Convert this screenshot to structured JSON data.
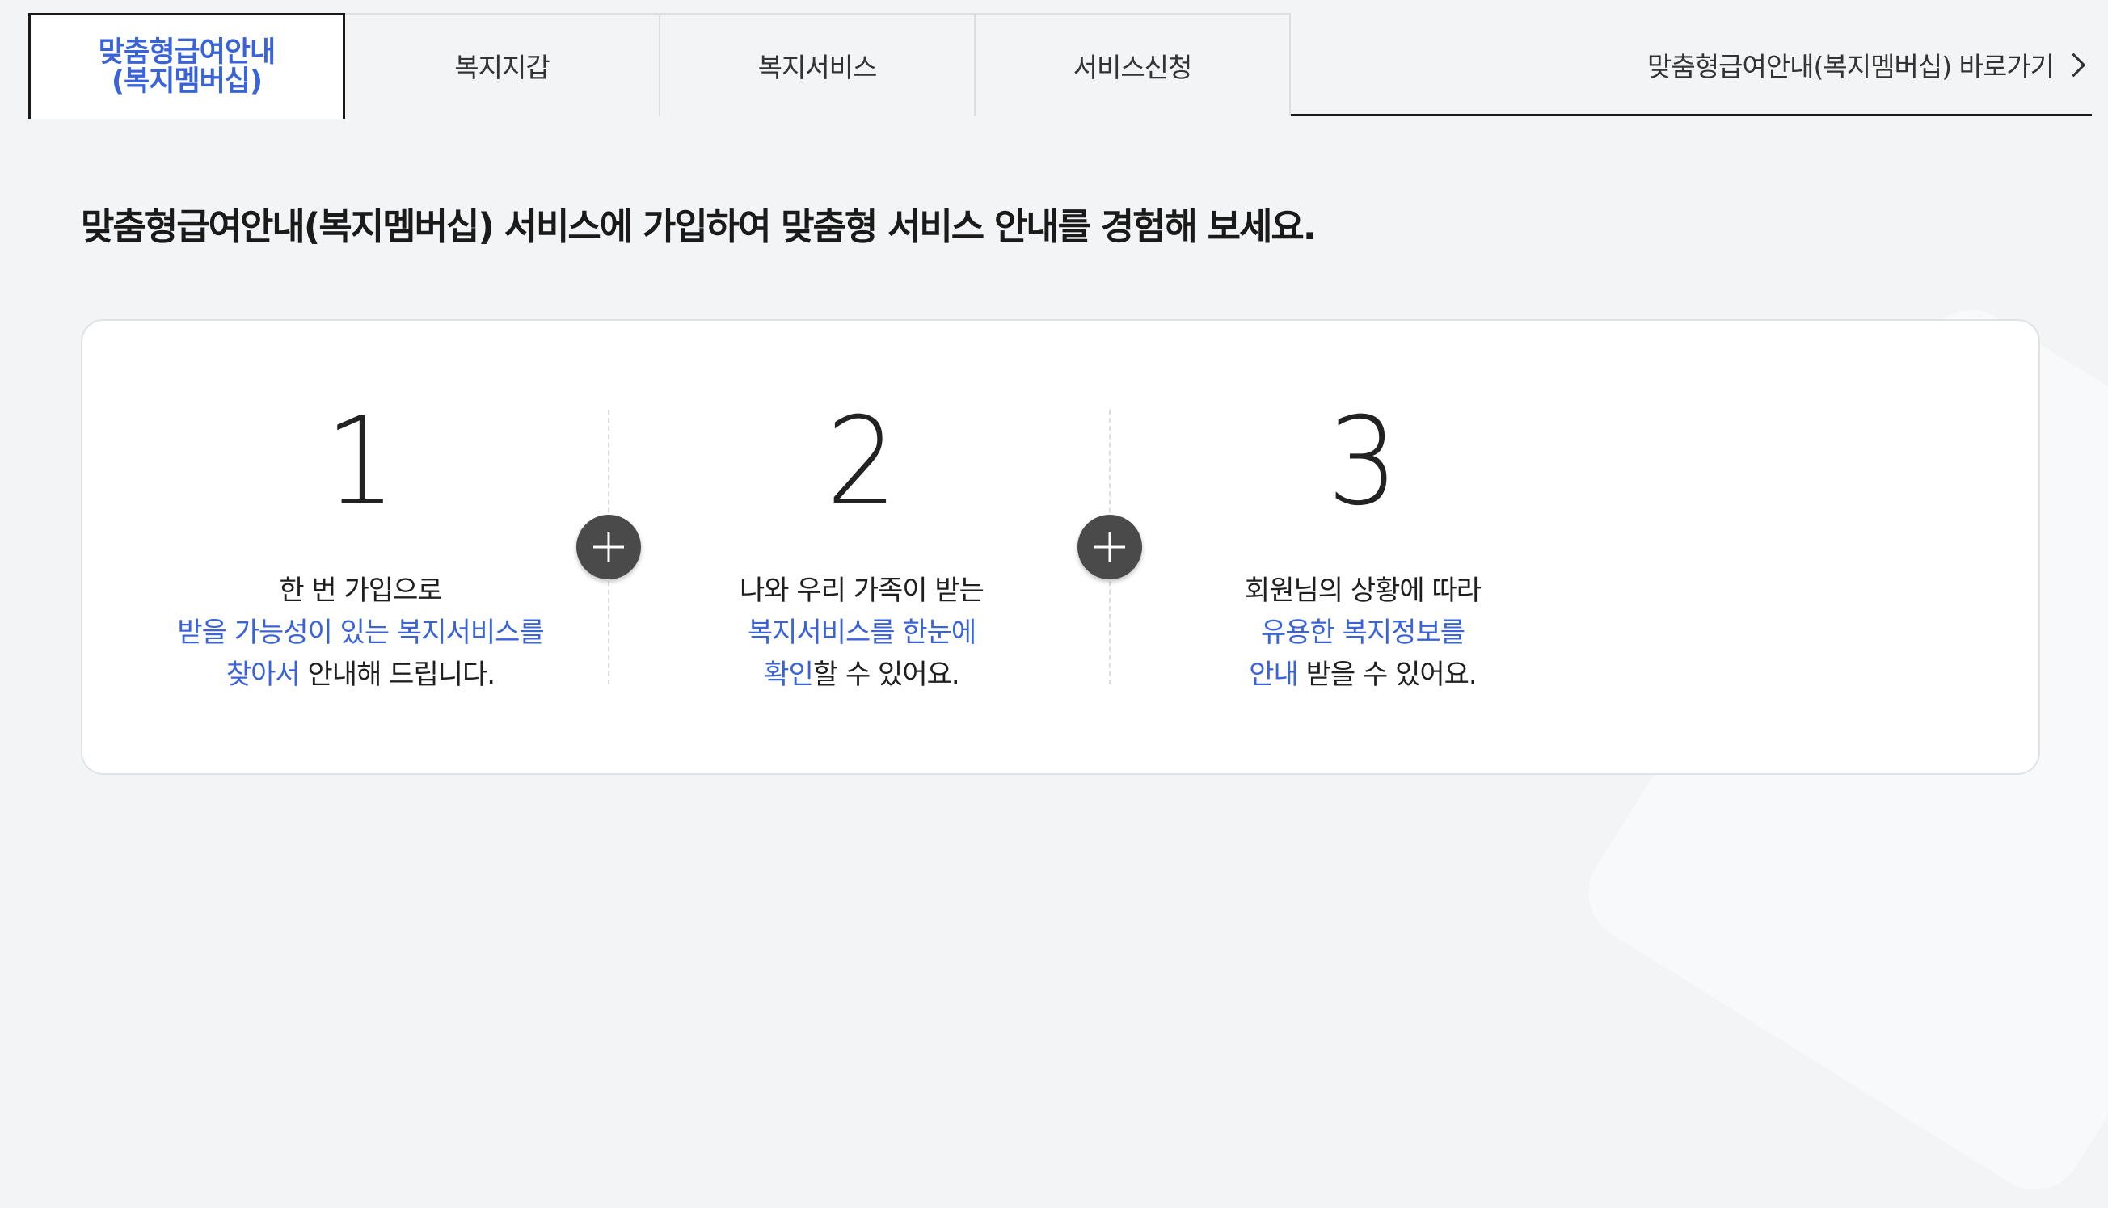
{
  "tabs": [
    {
      "label": "맞춤형급여안내\n(복지멤버십)",
      "active": true
    },
    {
      "label": "복지지갑",
      "active": false
    },
    {
      "label": "복지서비스",
      "active": false
    },
    {
      "label": "서비스신청",
      "active": false
    }
  ],
  "shortcut": {
    "label": "맞춤형급여안내(복지멤버십) 바로가기",
    "icon": "chevron-right-icon"
  },
  "headline": "맞춤형급여안내(복지멤버십) 서비스에 가입하여 맞춤형 서비스 안내를 경험해 보세요.",
  "steps": [
    {
      "number": "1",
      "line1": "한 번 가입으로",
      "line2_hl": "받을 가능성이 있는 복지서비스를",
      "line3_hl": "찾아서",
      "line3": " 안내해 드립니다."
    },
    {
      "number": "2",
      "line1": "나와 우리 가족이 받는",
      "line2_hl": "복지서비스를 한눈에",
      "line3_hl": "확인",
      "line3": "할 수 있어요."
    },
    {
      "number": "3",
      "line1": "회원님의 상황에 따라",
      "line2_hl": "유용한 복지정보를",
      "line3_hl": "안내",
      "line3": " 받을 수 있어요."
    }
  ],
  "colors": {
    "accent": "#3b63d8",
    "background": "#f2f4f5",
    "card": "#ffffff",
    "plus_button": "#4a4a4a"
  }
}
